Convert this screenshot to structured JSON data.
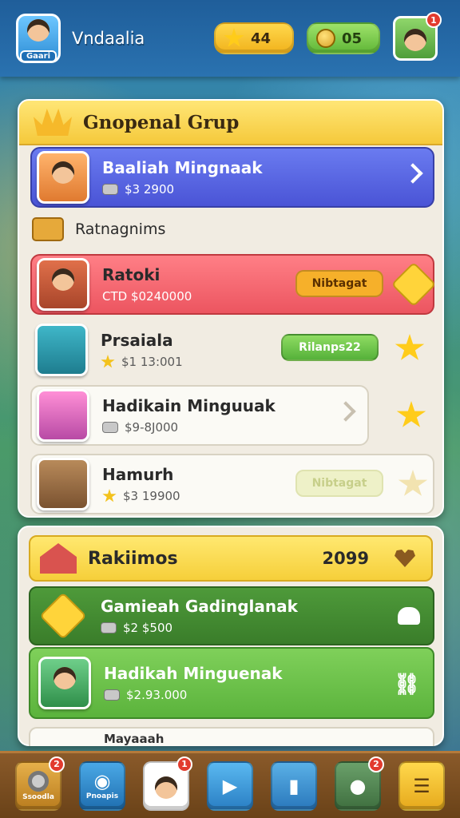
{
  "header": {
    "player_name": "Vndaalia",
    "profile_tag": "Gaari",
    "stars": "44",
    "coins": "05",
    "friend_badge": "1"
  },
  "panel_group": {
    "title": "Gnopenal Grup",
    "section_label": "Ratnagnims",
    "rows": [
      {
        "title": "Baaliah Mingnaak",
        "sub": "$3 2900",
        "style": "blue"
      },
      {
        "title": "Ratoki",
        "sub": "CTD $0240000",
        "button": "Nibtagat",
        "style": "red"
      },
      {
        "title": "Prsaiala",
        "sub": "$1 13:001",
        "button": "Rilanps22",
        "style": "plain"
      },
      {
        "title": "Hadikain Minguuak",
        "sub": "$9-8J000",
        "style": "white"
      },
      {
        "title": "Hamurh",
        "sub": "$3 19900",
        "button": "Nibtagat",
        "style": "white"
      }
    ]
  },
  "panel_rewards": {
    "title": "Rakiimos",
    "count": "2099",
    "rows": [
      {
        "title": "Gamieah Gadinglanak",
        "sub": "$2 $500"
      },
      {
        "title": "Hadikah Minguenak",
        "sub": "$2.93.000"
      }
    ],
    "peek_title": "Mayaaah"
  },
  "nav": {
    "items": [
      {
        "label": "Ssoodla",
        "badge": "2"
      },
      {
        "label": "Pnoapis",
        "badge": ""
      },
      {
        "label": "",
        "badge": "1"
      },
      {
        "label": "",
        "badge": ""
      },
      {
        "label": "",
        "badge": ""
      },
      {
        "label": "",
        "badge": "2"
      },
      {
        "label": "",
        "badge": ""
      }
    ]
  }
}
